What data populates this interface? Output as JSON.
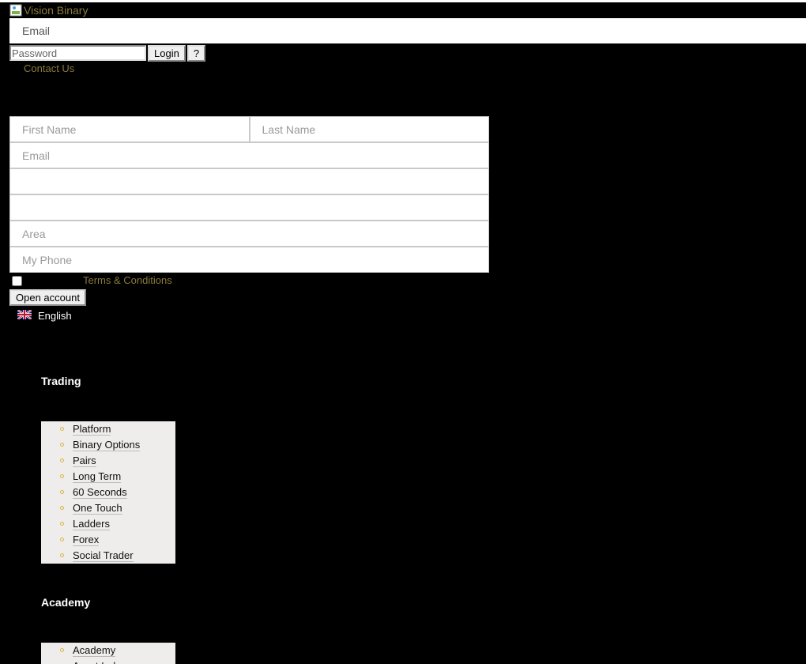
{
  "header": {
    "logo_alt": "Vision Binary",
    "login": {
      "email_placeholder": "Email",
      "password_placeholder": "Password",
      "login_label": "Login",
      "help_label": "?"
    },
    "contact_label": "Contact Us"
  },
  "register": {
    "first_name_placeholder": "First Name",
    "last_name_placeholder": "Last Name",
    "email_placeholder": "Email",
    "field4_value": "",
    "field5_value": "",
    "area_placeholder": "Area",
    "phone_placeholder": "My Phone",
    "terms_label": "Terms & Conditions",
    "submit_label": "Open account"
  },
  "language": {
    "label": "English",
    "icon": "uk-flag-icon"
  },
  "footer_nav": {
    "trading": {
      "title": "Trading",
      "items": [
        "Platform",
        "Binary Options",
        "Pairs",
        "Long Term",
        "60 Seconds",
        "One Touch",
        "Ladders",
        "Forex",
        "Social Trader"
      ]
    },
    "academy": {
      "title": "Academy",
      "items": [
        "Academy",
        "Asset Index"
      ]
    }
  },
  "colors": {
    "background": "#000000",
    "link_gold": "#8a7a3c",
    "menu_bg": "#efedeb",
    "bullet_gold": "#d9b54a"
  }
}
